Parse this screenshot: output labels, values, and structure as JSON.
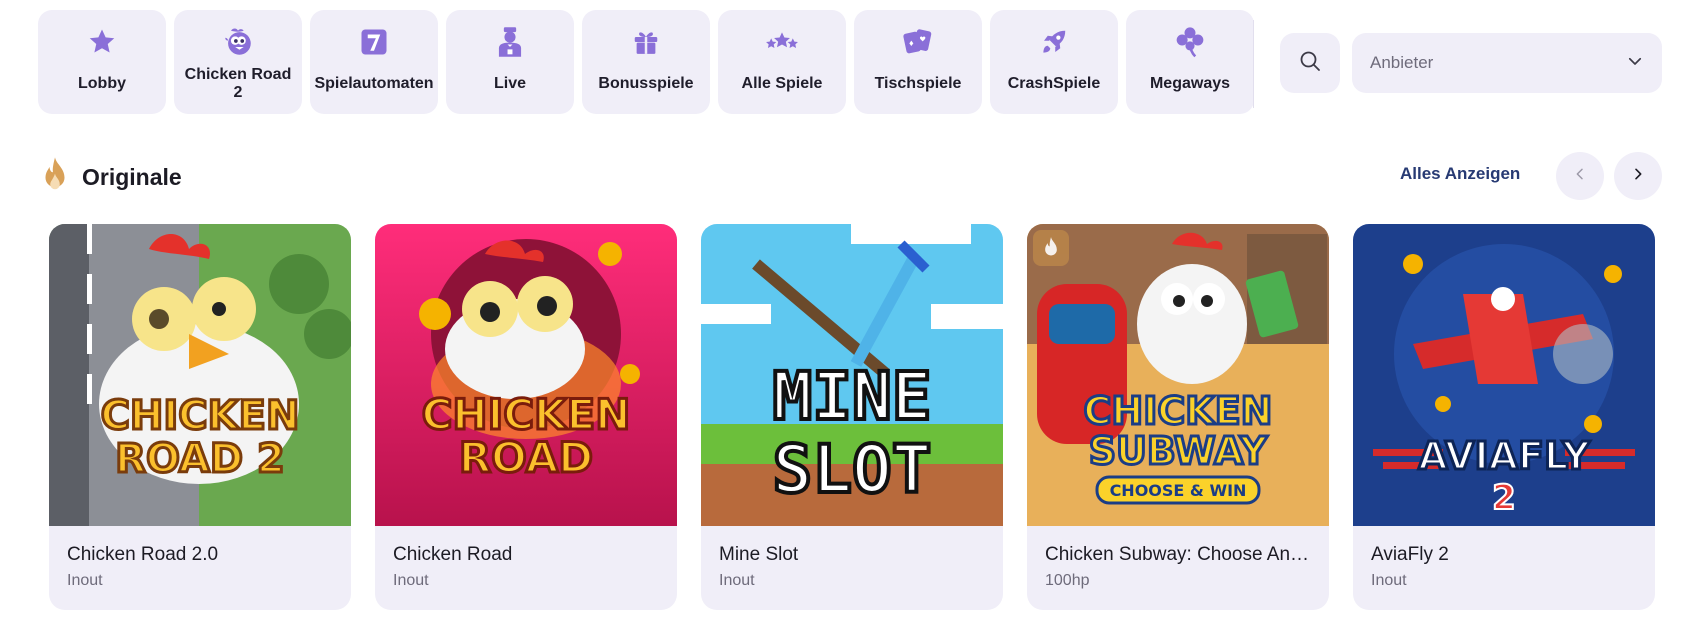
{
  "categories": [
    {
      "label": "Lobby",
      "icon": "star-icon"
    },
    {
      "label": "Chicken Road 2",
      "icon": "chicken-icon"
    },
    {
      "label": "Spielautomaten",
      "icon": "seven-icon"
    },
    {
      "label": "Live",
      "icon": "dealer-icon"
    },
    {
      "label": "Bonusspiele",
      "icon": "gift-icon"
    },
    {
      "label": "Alle Spiele",
      "icon": "stars-icon"
    },
    {
      "label": "Tischspiele",
      "icon": "cards-icon"
    },
    {
      "label": "CrashSpiele",
      "icon": "rocket-icon"
    },
    {
      "label": "Megaways",
      "icon": "clover-icon"
    }
  ],
  "search": {
    "icon": "search-icon"
  },
  "provider_select": {
    "placeholder": "Anbieter",
    "icon": "chevron-down-icon"
  },
  "section": {
    "title": "Originale",
    "icon": "flame-icon",
    "show_all_label": "Alles Anzeigen",
    "prev_icon": "chevron-left-icon",
    "next_icon": "chevron-right-icon"
  },
  "games": [
    {
      "title": "Chicken Road 2.0",
      "provider": "Inout",
      "art_text": [
        "CHICKEN",
        "ROAD 2"
      ]
    },
    {
      "title": "Chicken Road",
      "provider": "Inout",
      "art_text": [
        "CHICKEN",
        "ROAD"
      ]
    },
    {
      "title": "Mine Slot",
      "provider": "Inout",
      "art_text": [
        "MINE",
        "SLOT"
      ]
    },
    {
      "title": "Chicken Subway: Choose And Win",
      "provider": "100hp",
      "art_text": [
        "CHICKEN",
        "SUBWAY",
        "CHOOSE & WIN"
      ]
    },
    {
      "title": "AviaFly 2",
      "provider": "Inout",
      "art_text": [
        "AVIAFLY",
        "2"
      ]
    }
  ],
  "colors": {
    "accent": "#8a6fd8",
    "tile_bg": "#f0eef8",
    "link": "#273a73",
    "flame": "#d9a158"
  }
}
